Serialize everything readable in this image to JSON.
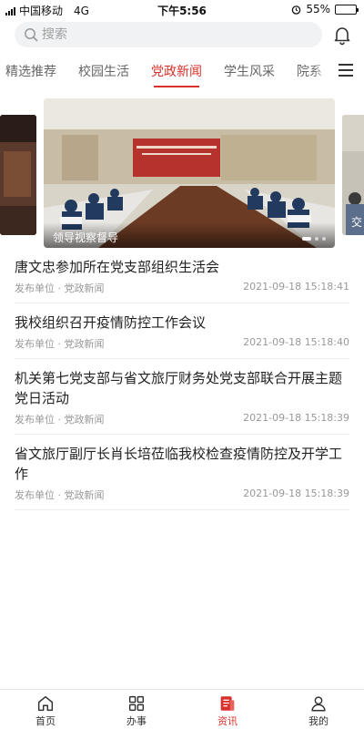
{
  "status_bar": {
    "carrier": "中国移动",
    "network": "4G",
    "time": "下午5:56",
    "battery": "55%",
    "battery_level": 0.55
  },
  "search": {
    "placeholder": "搜索"
  },
  "tabs": [
    {
      "label": "精选推荐",
      "active": false
    },
    {
      "label": "校园生活",
      "active": false
    },
    {
      "label": "党政新闻",
      "active": true
    },
    {
      "label": "学生风采",
      "active": false
    },
    {
      "label": "院系",
      "active": false
    }
  ],
  "banner": {
    "caption": "领导视察督导",
    "side_right_caption": "交"
  },
  "news": [
    {
      "title": "唐文忠参加所在党支部组织生活会",
      "publisher": "发布单位 · 党政新闻",
      "time": "2021-09-18 15:18:41"
    },
    {
      "title": "我校组织召开疫情防控工作会议",
      "publisher": "发布单位 · 党政新闻",
      "time": "2021-09-18 15:18:40"
    },
    {
      "title": "机关第七党支部与省文旅厅财务处党支部联合开展主题党日活动",
      "publisher": "发布单位 · 党政新闻",
      "time": "2021-09-18 15:18:39"
    },
    {
      "title": "省文旅厅副厅长肖长培莅临我校检查疫情防控及开学工作",
      "publisher": "发布单位 · 党政新闻",
      "time": "2021-09-18 15:18:39"
    }
  ],
  "bottom_nav": [
    {
      "label": "首页",
      "icon": "home-icon",
      "active": false
    },
    {
      "label": "办事",
      "icon": "grid-icon",
      "active": false
    },
    {
      "label": "资讯",
      "icon": "news-icon",
      "active": true
    },
    {
      "label": "我的",
      "icon": "user-icon",
      "active": false
    }
  ],
  "colors": {
    "accent": "#d9302b"
  }
}
